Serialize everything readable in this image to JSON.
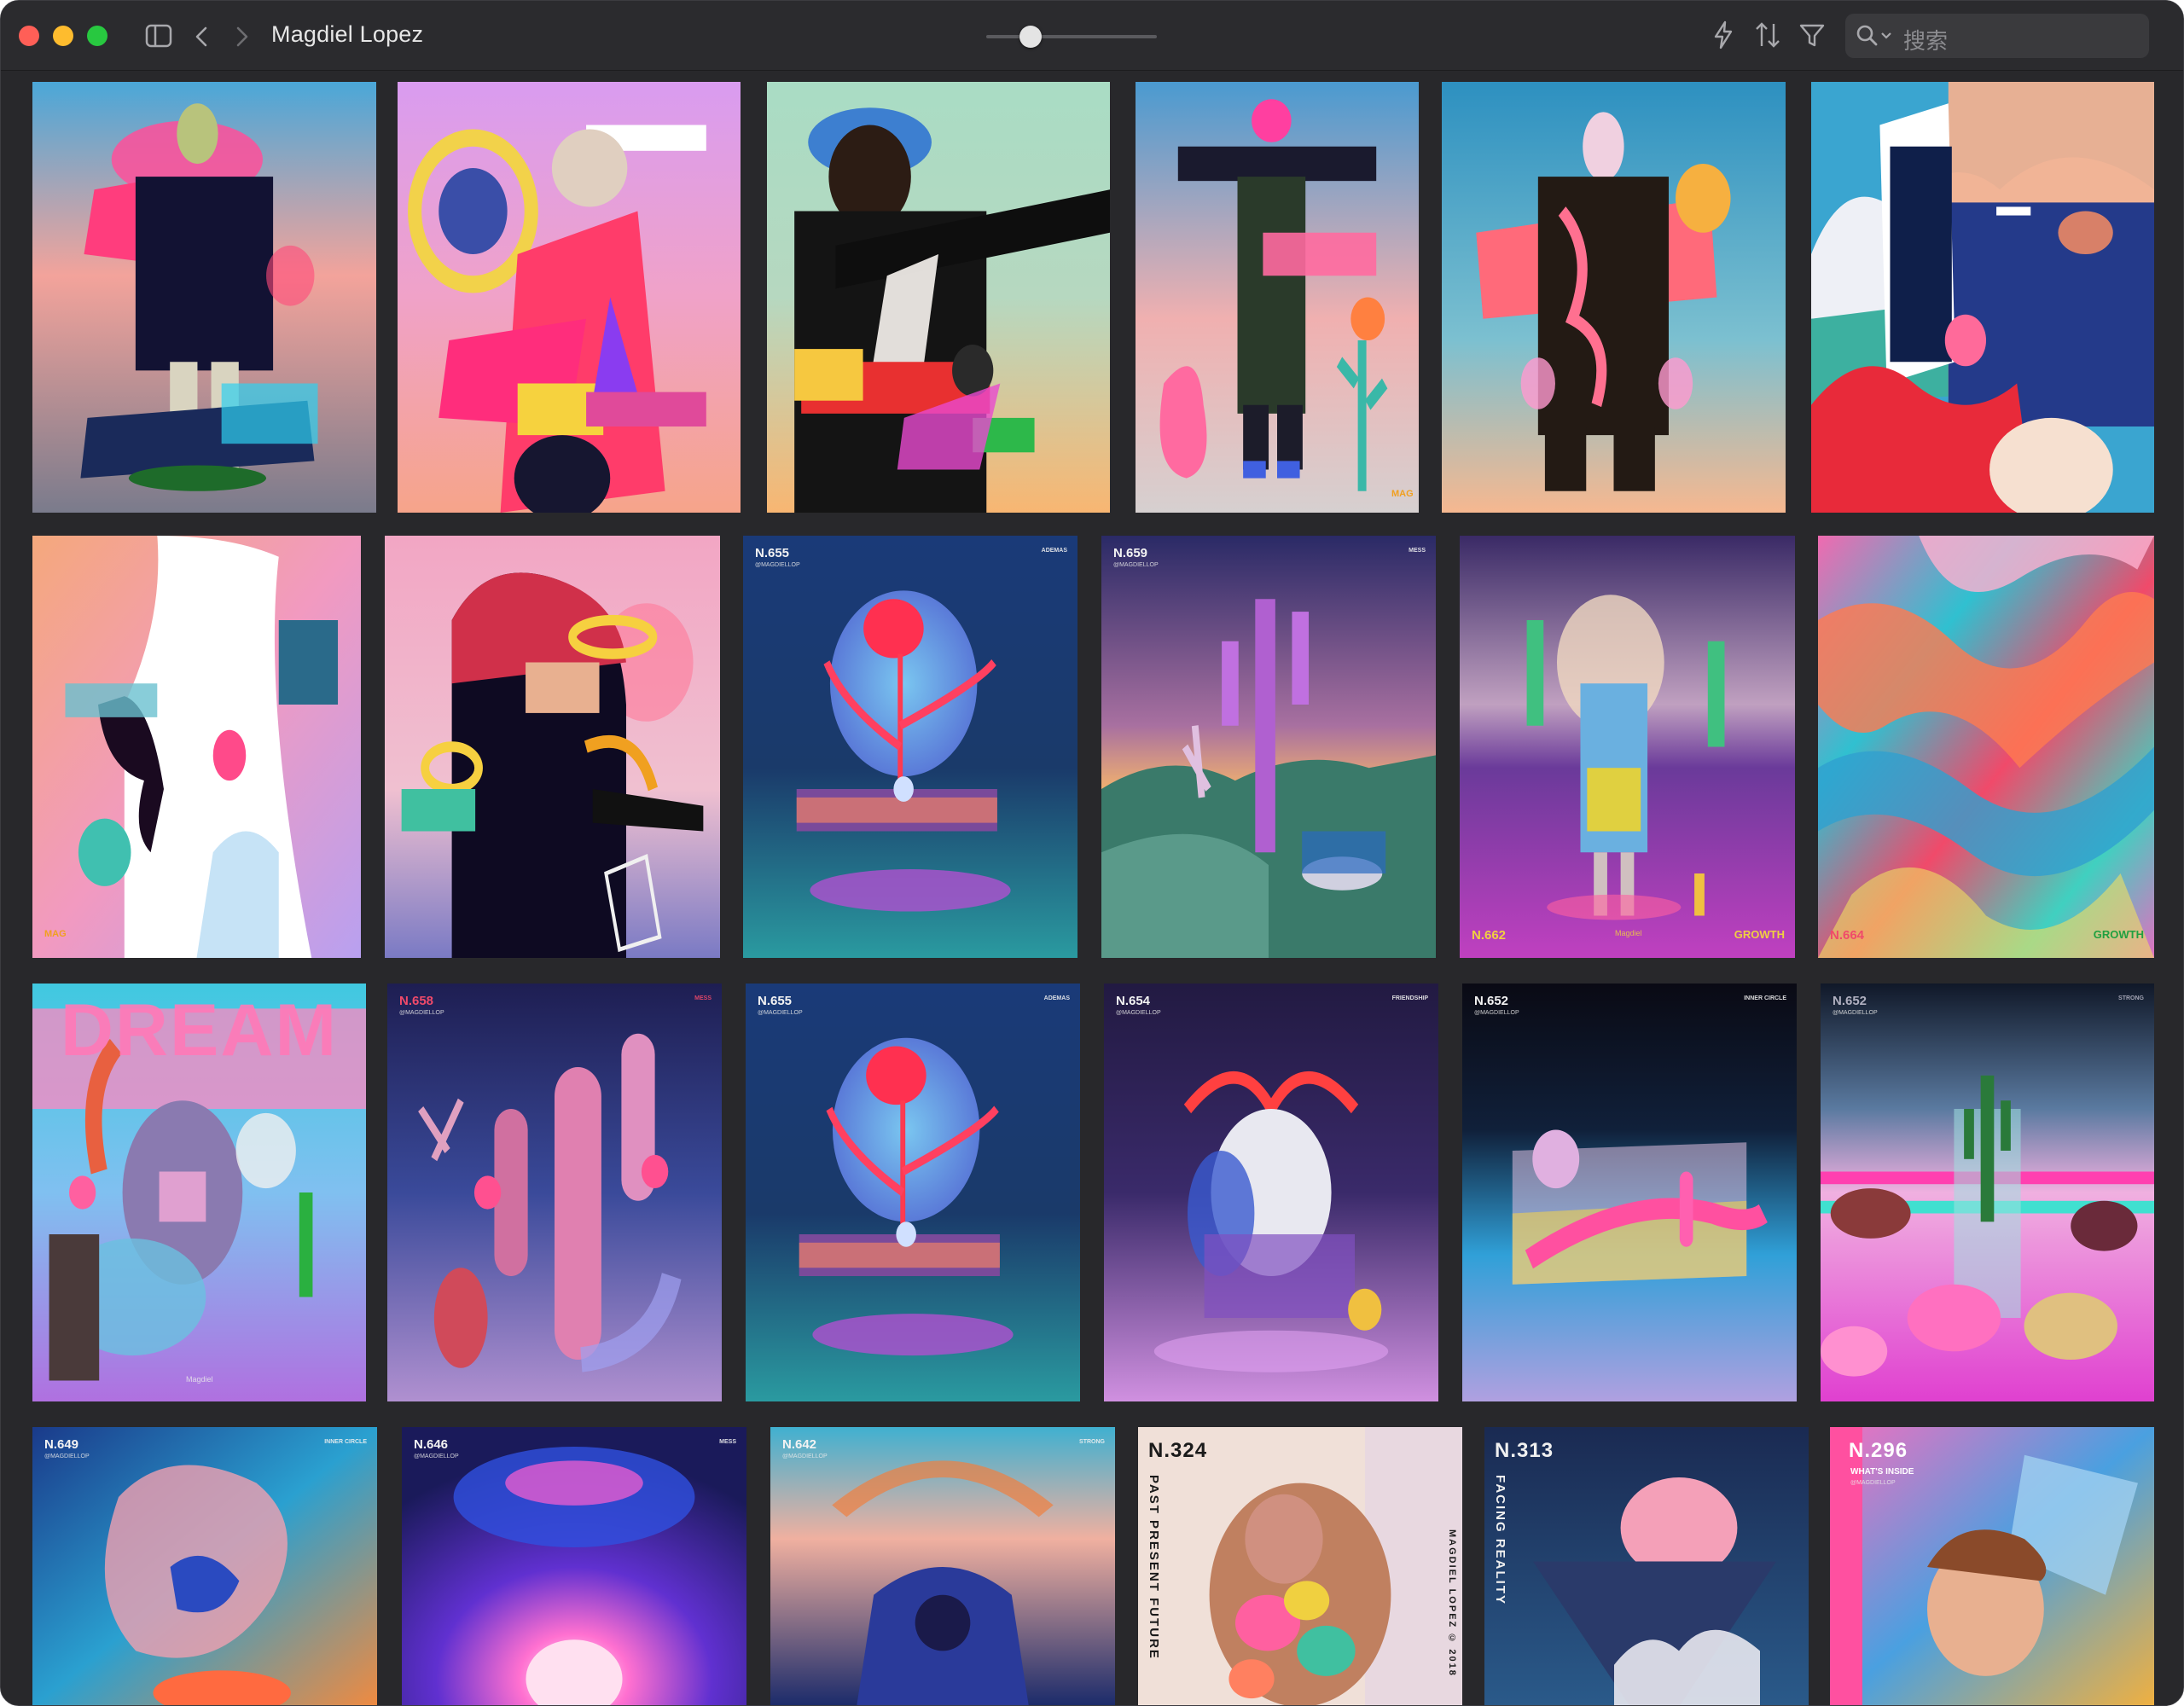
{
  "window": {
    "title": "Magdiel Lopez",
    "search_placeholder": "搜索",
    "toolbar_icons": [
      "sidebar-toggle-icon",
      "back-chevron-icon",
      "forward-chevron-icon",
      "lightning-icon",
      "sort-icon",
      "filter-icon",
      "search-icon"
    ],
    "zoom_slider_fraction": 0.25
  },
  "grid": {
    "row2": {
      "t3": {
        "num": "N.655",
        "right": "ADEMAS"
      },
      "t4": {
        "num": "N.659",
        "right": "MESS"
      },
      "t5": {
        "num": "N.662",
        "tag": "GROWTH",
        "center": "Magdiel"
      },
      "t6": {
        "num": "N.664",
        "tag": "GROWTH"
      }
    },
    "row3": {
      "t1": {
        "word": "DREAM",
        "center": "Magdiel"
      },
      "t2": {
        "num": "N.658",
        "right": "MESS"
      },
      "t3": {
        "num": "N.655",
        "right": "ADEMAS"
      },
      "t4": {
        "num": "N.654",
        "right": "FRIENDSHIP"
      },
      "t5": {
        "num": "N.652",
        "right": "INNER CIRCLE"
      },
      "t6": {
        "num": "N.652",
        "right": "STRONG"
      }
    },
    "row4": {
      "t1": {
        "num": "N.649",
        "right": "INNER CIRCLE"
      },
      "t2": {
        "num": "N.646",
        "right": "MESS"
      },
      "t3": {
        "num": "N.642",
        "right": "STRONG"
      },
      "t4": {
        "num": "N.324",
        "vertical": "PAST PRESENT FUTURE",
        "side": "MAGDIEL LOPEZ © 2018"
      },
      "t5": {
        "num": "N.313",
        "vertical": "FACING REALITY"
      },
      "t6": {
        "num": "N.296",
        "sub": "WHAT'S INSIDE"
      }
    },
    "handles": {
      "mag": "MAG",
      "handle": "@MAGDIELLOP"
    }
  }
}
